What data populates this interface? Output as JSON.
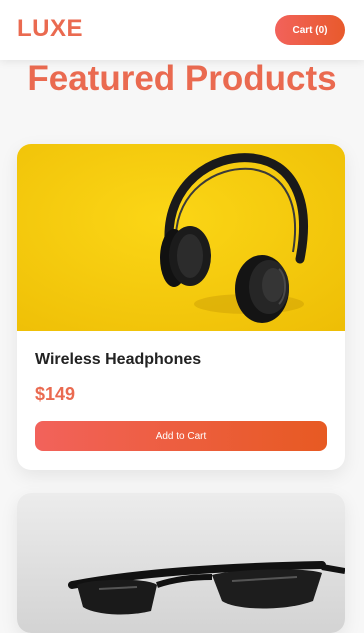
{
  "header": {
    "logo": "LUXE",
    "cart_label": "Cart (0)"
  },
  "main": {
    "heading": "Featured Products"
  },
  "products": [
    {
      "title": "Wireless Headphones",
      "price": "$149",
      "button_label": "Add to Cart",
      "image_icon": "headphones-photo"
    },
    {
      "image_icon": "sunglasses-photo"
    }
  ],
  "colors": {
    "accent": "#ea6a50",
    "gradient_start": "#f2625b",
    "gradient_end": "#e85a2c",
    "headphone_bg": "#f6c907"
  }
}
